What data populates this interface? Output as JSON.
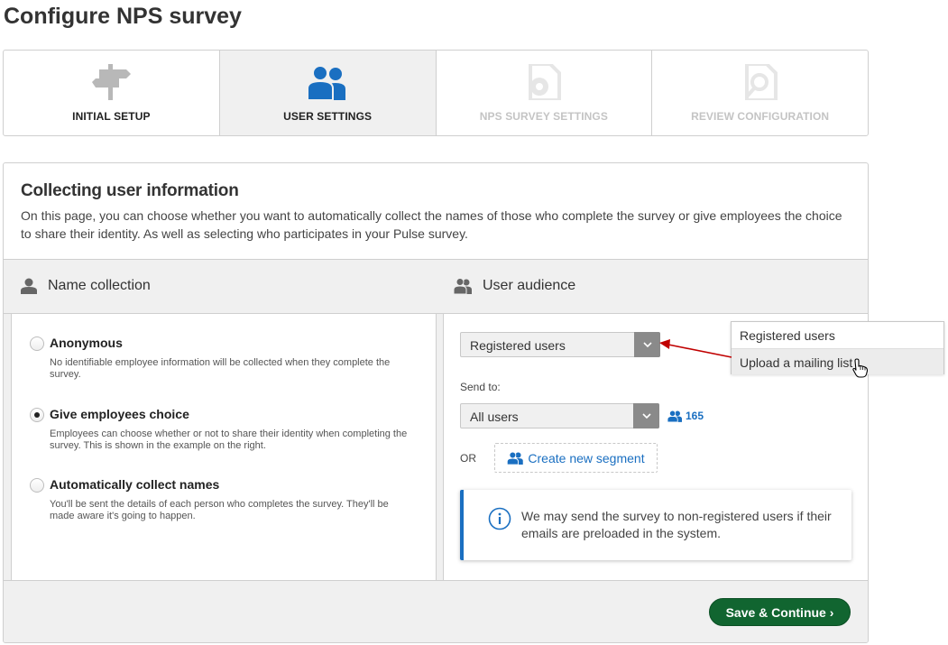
{
  "page": {
    "title": "Configure NPS survey"
  },
  "stepper": {
    "steps": [
      {
        "label": "INITIAL SETUP",
        "icon": "signpost-icon",
        "state": "done"
      },
      {
        "label": "USER SETTINGS",
        "icon": "users-icon",
        "state": "active"
      },
      {
        "label": "NPS SURVEY SETTINGS",
        "icon": "gear-document-icon",
        "state": "disabled"
      },
      {
        "label": "REVIEW CONFIGURATION",
        "icon": "magnifier-document-icon",
        "state": "disabled"
      }
    ]
  },
  "card": {
    "title": "Collecting user information",
    "description": "On this page, you can choose whether you want to automatically collect the names of those who complete the survey or give employees the choice to share their identity. As well as selecting who participates in your Pulse survey."
  },
  "name_collection": {
    "title": "Name collection",
    "options": [
      {
        "label": "Anonymous",
        "description": "No identifiable employee information will be collected when they complete the survey.",
        "checked": false
      },
      {
        "label": "Give employees choice",
        "description": "Employees can choose whether or not to share their identity when completing the survey. This is shown in the example on the right.",
        "checked": true
      },
      {
        "label": "Automatically collect names",
        "description": "You'll be sent the details of each person who completes the survey. They'll be made aware it's going to happen.",
        "checked": false
      }
    ]
  },
  "user_audience": {
    "title": "User audience",
    "audience_select": {
      "value": "Registered users"
    },
    "send_to_label": "Send to:",
    "send_to_select": {
      "value": "All users"
    },
    "user_count": "165",
    "or_label": "OR",
    "create_segment_label": "Create new segment",
    "info_text": "We may send the survey to non-registered users if their emails are preloaded in the system."
  },
  "dropdown": {
    "options": [
      "Registered users",
      "Upload a mailing list"
    ],
    "hovered_index": 1
  },
  "footer": {
    "save_label": "Save & Continue ›"
  },
  "colors": {
    "accent": "#1a6fc1",
    "primary_button": "#116530",
    "annotation_arrow": "#c00000"
  }
}
